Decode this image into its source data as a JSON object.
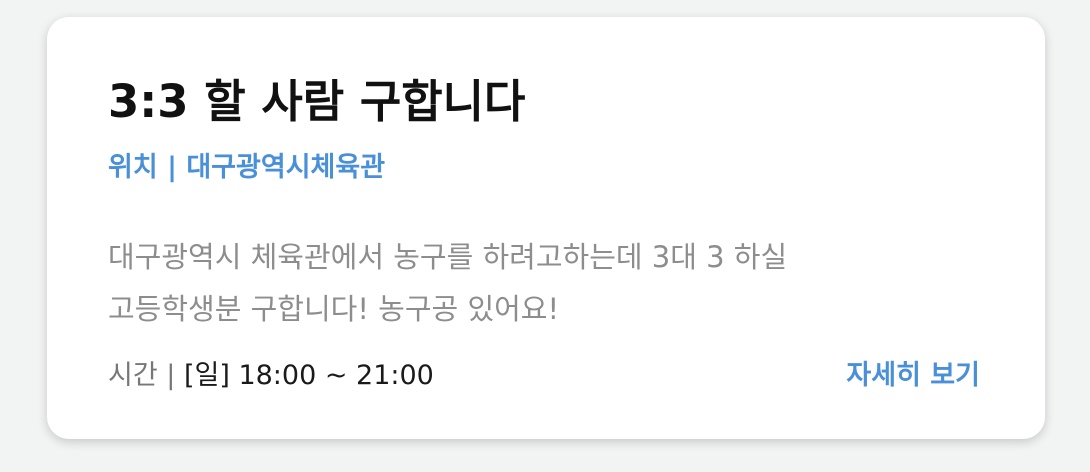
{
  "post": {
    "title": "3:3 할 사람 구합니다",
    "location": "위치 | 대구광역시체육관",
    "description_lines": [
      "대구광역시 체육관에서 농구를 하려고하는데 3대 3 하실",
      "고등학생분 구합니다! 농구공 있어요!"
    ],
    "time_label": "시간 | ",
    "time_value": "[일] 18:00 ~ 21:00",
    "detail_label": "자세히 보기"
  },
  "colors": {
    "accent": "#4a90d9",
    "title": "#111111",
    "description": "#8d8d8d",
    "background": "#f2f4f3",
    "card": "#ffffff"
  }
}
